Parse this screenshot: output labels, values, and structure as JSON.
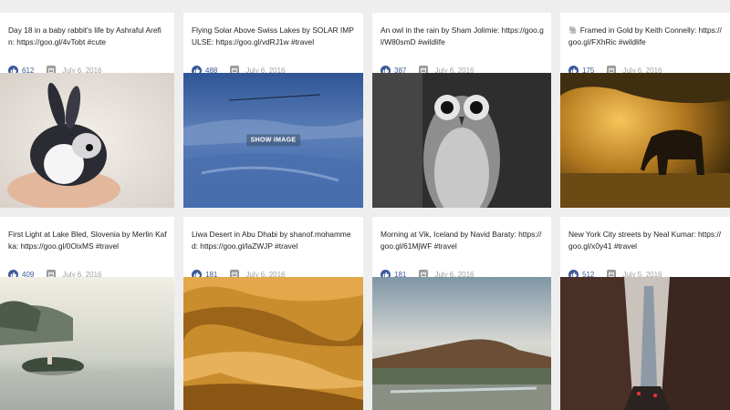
{
  "posts": [
    {
      "caption": "Day 18 in a baby rabbit's life by Ashraful Arefin: https://goo.gl/4vTobt #cute",
      "likes": "612",
      "date": "July 6, 2016",
      "photo": "rabbit"
    },
    {
      "caption": "Flying Solar Above Swiss Lakes by SOLAR IMPULSE: https://goo.gl/vdRJ1w #travel",
      "likes": "488",
      "date": "July 6, 2016",
      "photo": "solar-plane-over-lakes",
      "overlay": "SHOW IMAGE"
    },
    {
      "caption": "An owl in the rain by Sham Jolimie: https://goo.gl/W80smD #wildlife",
      "likes": "387",
      "date": "July 6, 2016",
      "photo": "owl"
    },
    {
      "caption": "🐘 Framed in Gold by Keith Connelly: https://goo.gl/FXhRic #wildlife",
      "likes": "175",
      "date": "July 6, 2016",
      "photo": "elephant"
    },
    {
      "caption": "First Light at Lake Bled, Slovenia by Merlin Kafka: https://goo.gl/0OixMS #travel",
      "likes": "409",
      "date": "July 6, 2016",
      "photo": "lake-bled"
    },
    {
      "caption": "Liwa Desert in Abu Dhabi by shanof.mohammed: https://goo.gl/laZWJP #travel",
      "likes": "181",
      "date": "July 6, 2016",
      "photo": "desert"
    },
    {
      "caption": "Morning at Vik, Iceland by Navid Baraty: https://goo.gl/61MjWF #travel",
      "likes": "181",
      "date": "July 6, 2016",
      "photo": "iceland"
    },
    {
      "caption": "New York City streets by Neal Kumar: https://goo.gl/x0y41 #travel",
      "likes": "512",
      "date": "July 5, 2016",
      "photo": "nyc-street"
    }
  ],
  "icons": {
    "like": "thumbs-up-icon",
    "date": "calendar-icon"
  },
  "colors": {
    "like": "#3b5998",
    "background": "#eeeeee",
    "card": "#ffffff"
  }
}
